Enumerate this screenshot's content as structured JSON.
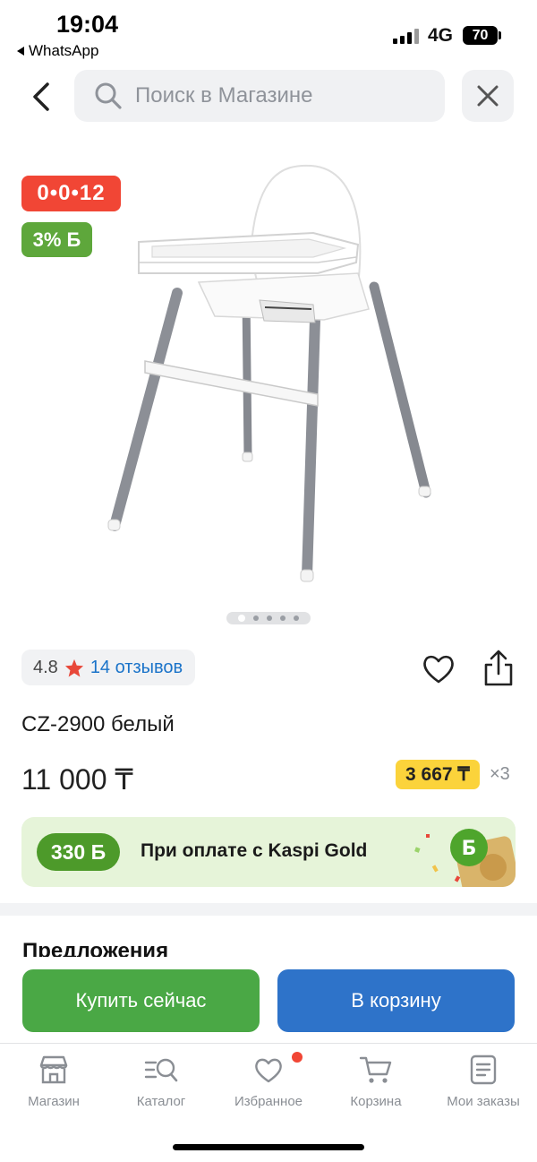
{
  "status_bar": {
    "time": "19:04",
    "back_app": "WhatsApp",
    "network": "4G",
    "battery": "70"
  },
  "search": {
    "placeholder": "Поиск в Магазине"
  },
  "badges": {
    "installment": "0•0•12",
    "bonus": "3% Б"
  },
  "product": {
    "rating": "4.8",
    "reviews": "14 отзывов",
    "title": "CZ-2900 белый",
    "price": "11 000 ₸",
    "installment_price": "3 667 ₸",
    "installment_mult": "×3",
    "gallery_total": 5,
    "gallery_active": 1
  },
  "gold_banner": {
    "bonus": "330 Б",
    "text": "При оплате с Kaspi Gold"
  },
  "offers": {
    "title": "Предложения"
  },
  "actions": {
    "buy_now": "Купить сейчас",
    "add_to_cart": "В корзину"
  },
  "tabbar": {
    "items": [
      {
        "label": "Магазин",
        "icon": "store-icon"
      },
      {
        "label": "Каталог",
        "icon": "catalog-icon"
      },
      {
        "label": "Избранное",
        "icon": "heart-icon"
      },
      {
        "label": "Корзина",
        "icon": "cart-icon"
      },
      {
        "label": "Мои заказы",
        "icon": "orders-icon"
      }
    ]
  },
  "colors": {
    "red": "#f14635",
    "green": "#5ea73b",
    "buy": "#4aa845",
    "cart": "#2e73c9",
    "link": "#1a73c9",
    "yellow": "#fbd33b"
  }
}
